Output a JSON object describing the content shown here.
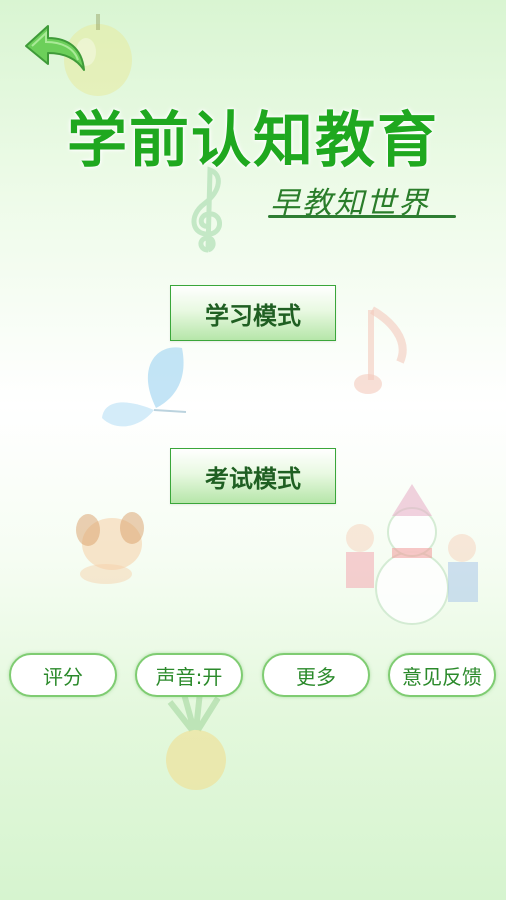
{
  "app": {
    "title": "学前认知教育",
    "subtitle": "早教知世界"
  },
  "modes": {
    "study_label": "学习模式",
    "exam_label": "考试模式"
  },
  "bottom_bar": {
    "rate_label": "评分",
    "sound_label": "声音:开",
    "more_label": "更多",
    "feedback_label": "意见反馈"
  },
  "icons": {
    "back": "back-arrow-icon"
  },
  "colors": {
    "title_green": "#1fa81f",
    "button_border": "#3aa63a",
    "pill_border": "#7fcc72"
  }
}
